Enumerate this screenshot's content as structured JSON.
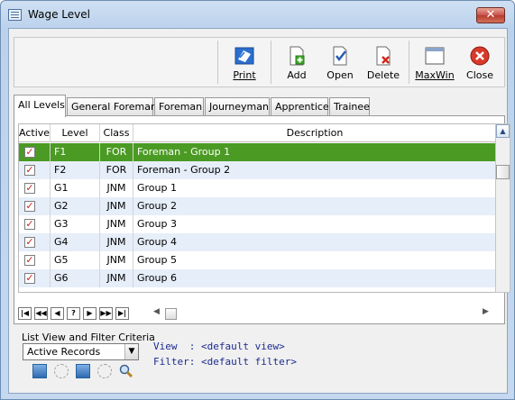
{
  "window": {
    "title": "Wage Level"
  },
  "toolbar": {
    "print": "Print",
    "add": "Add",
    "open": "Open",
    "delete": "Delete",
    "maxwin": "MaxWin",
    "close": "Close"
  },
  "tabs": [
    "All Levels",
    "General Foreman",
    "Foreman",
    "Journeyman",
    "Apprentice",
    "Trainee"
  ],
  "grid": {
    "columns": [
      "Active",
      "Level",
      "Class",
      "Description"
    ],
    "rows": [
      {
        "active": "✓",
        "level": "F1",
        "class": "FOR",
        "description": "Foreman - Group 1"
      },
      {
        "active": "✓",
        "level": "F2",
        "class": "FOR",
        "description": "Foreman - Group 2"
      },
      {
        "active": "✓",
        "level": "G1",
        "class": "JNM",
        "description": "Group 1"
      },
      {
        "active": "✓",
        "level": "G2",
        "class": "JNM",
        "description": "Group 2"
      },
      {
        "active": "✓",
        "level": "G3",
        "class": "JNM",
        "description": "Group 3"
      },
      {
        "active": "✓",
        "level": "G4",
        "class": "JNM",
        "description": "Group 4"
      },
      {
        "active": "✓",
        "level": "G5",
        "class": "JNM",
        "description": "Group 5"
      },
      {
        "active": "✓",
        "level": "G6",
        "class": "JNM",
        "description": "Group 6"
      }
    ],
    "selected_row": 0,
    "nav": [
      "|◀",
      "◀◀",
      "◀",
      "?",
      "▶",
      "▶▶",
      "▶|"
    ]
  },
  "filter": {
    "label": "List View and Filter Criteria",
    "selected": "Active Records",
    "view_text": "View  : <default view>",
    "filter_text": "Filter: <default filter>"
  },
  "colors": {
    "selected_row": "#4a9a23",
    "alt_row": "#e6eef9"
  }
}
